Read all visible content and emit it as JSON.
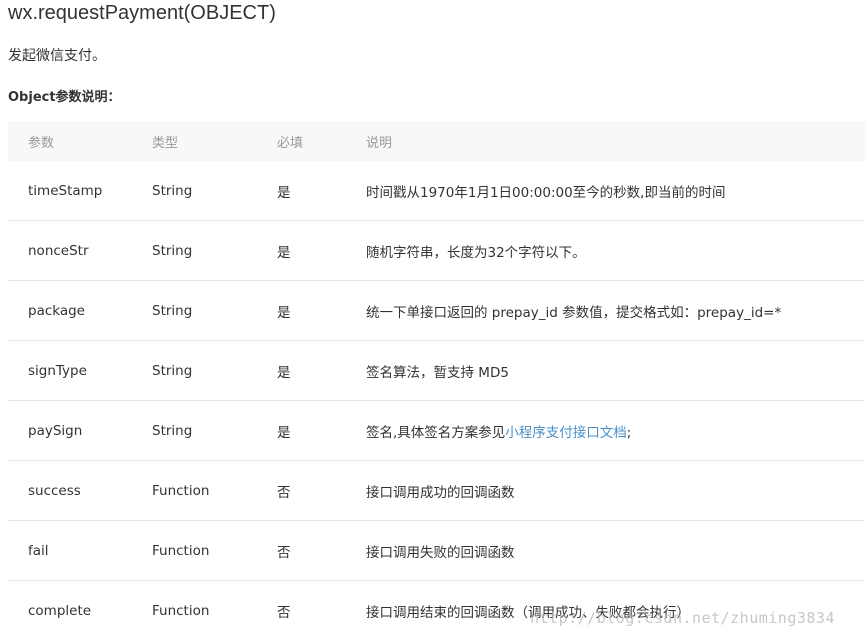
{
  "header": {
    "title": "wx.requestPayment(OBJECT)",
    "description": "发起微信支付。",
    "section_heading": "Object参数说明："
  },
  "table": {
    "columns": [
      "参数",
      "类型",
      "必填",
      "说明"
    ],
    "rows": [
      {
        "name": "timeStamp",
        "type": "String",
        "required": "是",
        "desc_prefix": "时间戳从1970年1月1日00:00:00至今的秒数,即当前的时间",
        "desc_link": "",
        "desc_suffix": ""
      },
      {
        "name": "nonceStr",
        "type": "String",
        "required": "是",
        "desc_prefix": "随机字符串，长度为32个字符以下。",
        "desc_link": "",
        "desc_suffix": ""
      },
      {
        "name": "package",
        "type": "String",
        "required": "是",
        "desc_prefix": "统一下单接口返回的 prepay_id 参数值，提交格式如：prepay_id=*",
        "desc_link": "",
        "desc_suffix": ""
      },
      {
        "name": "signType",
        "type": "String",
        "required": "是",
        "desc_prefix": "签名算法，暂支持 MD5",
        "desc_link": "",
        "desc_suffix": ""
      },
      {
        "name": "paySign",
        "type": "String",
        "required": "是",
        "desc_prefix": "签名,具体签名方案参见",
        "desc_link": "小程序支付接口文档",
        "desc_suffix": ";"
      },
      {
        "name": "success",
        "type": "Function",
        "required": "否",
        "desc_prefix": "接口调用成功的回调函数",
        "desc_link": "",
        "desc_suffix": ""
      },
      {
        "name": "fail",
        "type": "Function",
        "required": "否",
        "desc_prefix": "接口调用失败的回调函数",
        "desc_link": "",
        "desc_suffix": ""
      },
      {
        "name": "complete",
        "type": "Function",
        "required": "否",
        "desc_prefix": "接口调用结束的回调函数（调用成功、失败都会执行）",
        "desc_link": "",
        "desc_suffix": ""
      }
    ]
  },
  "colors": {
    "header_bg": "#f6f8fa",
    "header_text": "#999999",
    "link": "#4a90c8",
    "row_border": "#e7e7eb"
  },
  "watermark": "http://blog.csdn.net/zhuming3834"
}
